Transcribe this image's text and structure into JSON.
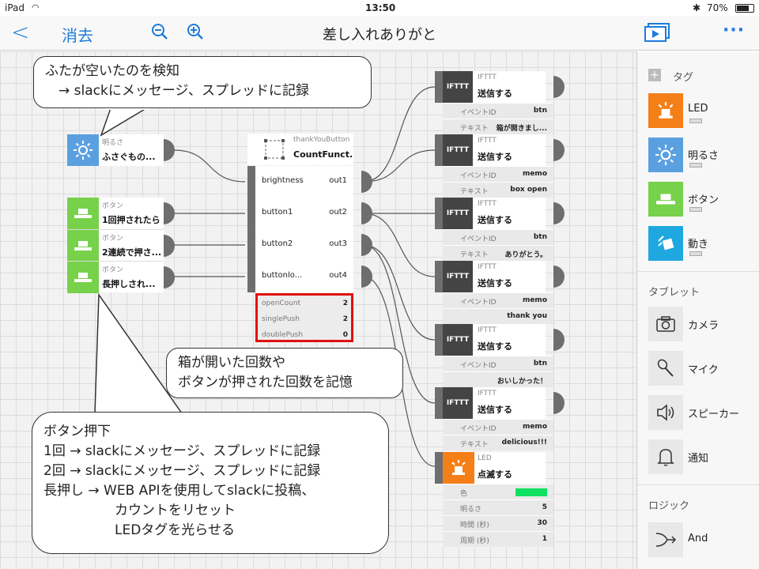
{
  "status_bar": {
    "device": "iPad",
    "time": "13:50",
    "battery": "70%"
  },
  "navbar": {
    "back": "<",
    "clear": "消去",
    "title": "差し入れありがと",
    "more": "···"
  },
  "canvas": {
    "callout_top": {
      "line1": "ふたが空いたのを検知",
      "line2": "　→ slackにメッセージ、スプレッドに記録"
    },
    "callout_middle": {
      "line1": "箱が開いた回数や",
      "line2": "ボタンが押された回数を記憶"
    },
    "callout_bottom": {
      "line1": "ボタン押下",
      "line2": "1回 → slackにメッセージ、スプレッドに記録",
      "line3": "2回 → slackにメッセージ、スプレッドに記録",
      "line4": "長押し → WEB APIを使用してslackに投稿、",
      "line5": "カウントをリセット",
      "line6": "LEDタグを光らせる"
    },
    "input_blocks": [
      {
        "type": "明るさ",
        "name": "ふさぐもの...",
        "color": "#5aa0e0",
        "icon": "sun-icon"
      },
      {
        "type": "ボタン",
        "name": "1回押されたら",
        "color": "#77d14a",
        "icon": "button-icon"
      },
      {
        "type": "ボタン",
        "name": "2連続で押さ...",
        "color": "#77d14a",
        "icon": "button-icon"
      },
      {
        "type": "ボタン",
        "name": "長押しされ...",
        "color": "#77d14a",
        "icon": "button-icon"
      }
    ],
    "function_block": {
      "type": "thankYouButton",
      "name": "CountFunct...",
      "inputs": [
        "brightness",
        "button1",
        "button2",
        "buttonlo..."
      ],
      "outputs": [
        "out1",
        "out2",
        "out3",
        "out4"
      ],
      "memory": [
        {
          "key": "openCount",
          "value": "2"
        },
        {
          "key": "singlePush",
          "value": "2"
        },
        {
          "key": "doublePush",
          "value": "0"
        }
      ]
    },
    "ifttt_blocks": [
      {
        "type": "IFTTT",
        "name": "送信する",
        "logo": "IFTTT",
        "props": [
          {
            "key": "イベントID",
            "value": "btn"
          },
          {
            "key": "テキスト",
            "value": "箱が開きまし..."
          }
        ]
      },
      {
        "type": "IFTTT",
        "name": "送信する",
        "logo": "IFTTT",
        "props": [
          {
            "key": "イベントID",
            "value": "memo"
          },
          {
            "key": "テキスト",
            "value": "box open"
          }
        ]
      },
      {
        "type": "IFTTT",
        "name": "送信する",
        "logo": "IFTTT",
        "props": [
          {
            "key": "イベントID",
            "value": "btn"
          },
          {
            "key": "テキスト",
            "value": "ありがとう。"
          }
        ]
      },
      {
        "type": "IFTTT",
        "name": "送信する",
        "logo": "IFTTT",
        "props": [
          {
            "key": "イベントID",
            "value": "memo"
          },
          {
            "key": "",
            "value": "thank you"
          }
        ]
      },
      {
        "type": "IFTTT",
        "name": "送信する",
        "logo": "IFTTT",
        "props": [
          {
            "key": "イベントID",
            "value": "btn"
          },
          {
            "key": "",
            "value": "おいしかった！"
          }
        ]
      },
      {
        "type": "IFTTT",
        "name": "送信する",
        "logo": "IFTTT",
        "props": [
          {
            "key": "イベントID",
            "value": "memo"
          },
          {
            "key": "テキスト",
            "value": "delicious!!!"
          }
        ]
      }
    ],
    "led_block": {
      "type": "LED",
      "name": "点滅する",
      "props": [
        {
          "key": "色",
          "value": "",
          "swatch": "#10e060"
        },
        {
          "key": "明るさ",
          "value": "5"
        },
        {
          "key": "時間 (秒)",
          "value": "30"
        },
        {
          "key": "周期 (秒)",
          "value": "1"
        }
      ]
    }
  },
  "sidebar": {
    "tag_header": "タグ",
    "tags": [
      {
        "label": "LED",
        "color": "#f47f16",
        "icon": "led-icon"
      },
      {
        "label": "明るさ",
        "color": "#5aa0e0",
        "icon": "sun-icon"
      },
      {
        "label": "ボタン",
        "color": "#77d14a",
        "icon": "button-icon"
      },
      {
        "label": "動き",
        "color": "#1fa8e0",
        "icon": "motion-icon"
      }
    ],
    "tablet_header": "タブレット",
    "tablet_items": [
      {
        "label": "カメラ",
        "icon": "camera-icon"
      },
      {
        "label": "マイク",
        "icon": "microphone-icon"
      },
      {
        "label": "スピーカー",
        "icon": "speaker-icon"
      },
      {
        "label": "通知",
        "icon": "bell-icon"
      }
    ],
    "logic_header": "ロジック",
    "logic_items": [
      {
        "label": "And",
        "icon": "and-merge-icon"
      }
    ]
  }
}
